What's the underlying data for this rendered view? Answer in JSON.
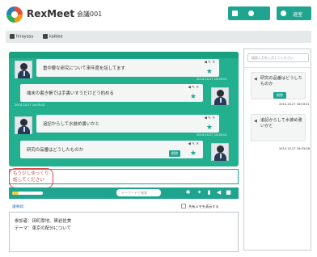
{
  "header": {
    "brand": "RexMeet",
    "meeting_title": "会議001",
    "exit_label": "退室"
  },
  "participants": [
    {
      "name": "hirayasu"
    },
    {
      "name": "kaibee"
    }
  ],
  "chat": {
    "messages": [
      {
        "side": "left",
        "text": "重中要な研究について来年度を話してます",
        "timestamp": "2014.10.27 14:05:01",
        "speaker": "Hirayasu"
      },
      {
        "side": "right",
        "text": "端末の書き帳では手書いすうだけどう約める",
        "timestamp": "2014.10.27 14:05:01",
        "speaker": "Hirayasu"
      },
      {
        "side": "left",
        "text": "追記からして水彼め書いかと",
        "timestamp": "2014.10.27 14:05:01",
        "speaker": "kaibee"
      },
      {
        "side": "left",
        "text": "研究の品番はどうしたものか",
        "timestamp": "2014.10.27 14:05:01",
        "speaker": "Hirayasu",
        "tag": "削除"
      }
    ]
  },
  "warning": {
    "text": "もう少しゆっくり話してください"
  },
  "toolbar": {
    "progress": 0.22,
    "keyword_placeholder": "キーワードで検索"
  },
  "minutes": {
    "label": "議事録：",
    "share_label": "共有メモを表示する",
    "lines": [
      "参加者：田町厚地、黒岩佐美",
      "テーマ：東京の配分について"
    ]
  },
  "sidebar": {
    "search_placeholder": "検索入力を入力してください",
    "bookmarks": [
      {
        "text": "研究の品番はどうしたものか",
        "button": "削除",
        "timestamp": "2014.10.27 16:03:41"
      },
      {
        "text": "追記からして水彼め書いかと",
        "button": "削除",
        "timestamp": "2014.10.27 16:03:08"
      }
    ]
  },
  "colors": {
    "accent": "#1fa58f",
    "chat_bg": "#23b08f",
    "warning": "#d94b4b"
  }
}
